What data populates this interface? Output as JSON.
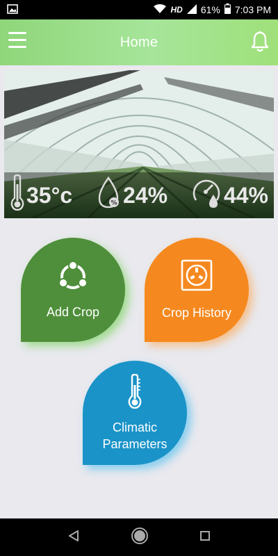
{
  "status_bar": {
    "network": "HD",
    "battery": "61%",
    "time": "7:03 PM"
  },
  "app_bar": {
    "title": "Home"
  },
  "banner": {
    "temperature": "35°c",
    "humidity": "24%",
    "moisture": "44%"
  },
  "tiles": {
    "add_crop": "Add Crop",
    "crop_history": "Crop History",
    "climatic_line1": "Climatic",
    "climatic_line2": "Parameters"
  },
  "colors": {
    "app_bar": "#9fe07a",
    "add_crop": "#4f8f3b",
    "crop_history": "#f5891f",
    "climatic": "#1a93c8"
  },
  "icons": [
    "image-icon",
    "wifi-icon",
    "signal-icon",
    "battery-icon",
    "menu-icon",
    "bell-icon",
    "thermometer-icon",
    "humidity-drop-icon",
    "gauge-drop-icon",
    "share-circle-icon",
    "socket-icon",
    "back-icon",
    "home-icon",
    "recents-icon"
  ]
}
